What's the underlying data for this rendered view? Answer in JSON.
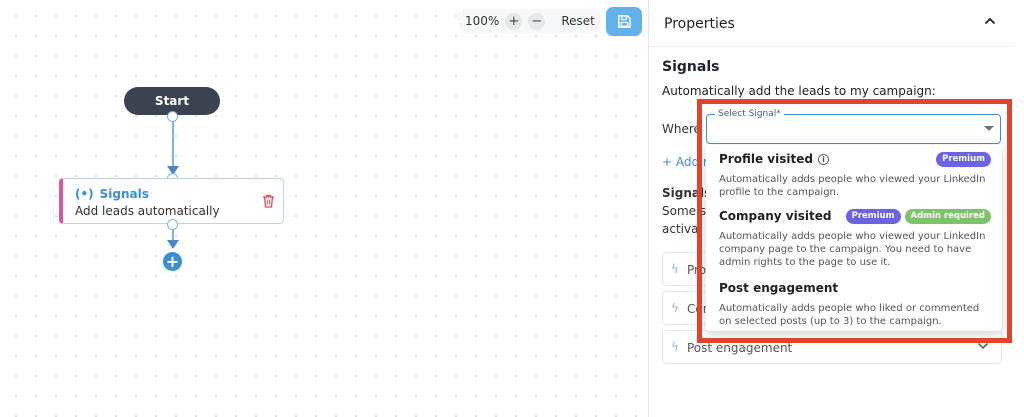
{
  "toolbar": {
    "zoom": "100%",
    "zoom_in": "+",
    "zoom_out": "−",
    "reset": "Reset"
  },
  "flow": {
    "start_label": "Start",
    "signal_title": "Signals",
    "signal_subtitle": "Add leads automatically",
    "add_step": "+"
  },
  "panel": {
    "title": "Properties",
    "section_title": "Signals",
    "description": "Automatically add the leads to my campaign:",
    "behind": {
      "where_prefix": "Where",
      "add_link_prefix": "+ Add ru",
      "signals_heading": "Signals",
      "some_text": "Some sig",
      "activa_text": "activa"
    },
    "accordion": [
      {
        "label": "Prof"
      },
      {
        "label": "Con"
      },
      {
        "label": "Post engagement"
      }
    ]
  },
  "select": {
    "label": "Select Signal",
    "required_mark": "*",
    "options": [
      {
        "name": "Profile visited",
        "description": "Automatically adds people who viewed your LinkedIn profile to the campaign.",
        "badges": [
          {
            "text": "Premium",
            "color": "#6b63e6"
          }
        ]
      },
      {
        "name": "Company visited",
        "description": "Automatically adds people who viewed your LinkedIn company page to the campaign. You need to have admin rights to the page to use it.",
        "badges": [
          {
            "text": "Premium",
            "color": "#6b63e6"
          },
          {
            "text": "Admin required",
            "color": "#7cc36a"
          }
        ]
      },
      {
        "name": "Post engagement",
        "description": "Automatically adds people who liked or commented on selected posts (up to 3) to the campaign.",
        "badges": []
      }
    ]
  },
  "colors": {
    "accent": "#3b8ed6",
    "highlight": "#e0452c",
    "start_node": "#3b4250",
    "signal_bar": "#e0559a"
  }
}
